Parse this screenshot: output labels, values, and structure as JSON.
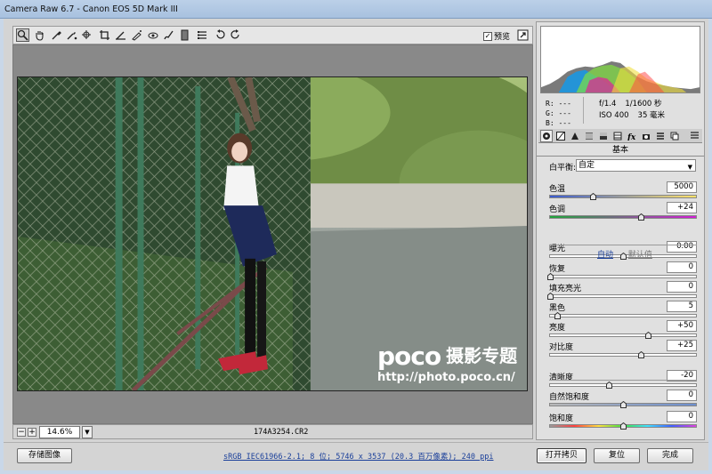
{
  "window": {
    "title": "Camera Raw 6.7  -  Canon EOS 5D Mark III"
  },
  "toolbar": {
    "tools": [
      "zoom-icon",
      "hand-icon",
      "white-balance-icon",
      "color-sampler-icon",
      "target-adjust-icon",
      "crop-icon",
      "straighten-icon",
      "spot-removal-icon",
      "red-eye-icon",
      "adjustment-brush-icon",
      "graduated-filter-icon",
      "preferences-icon",
      "rotate-left-icon",
      "rotate-right-icon"
    ],
    "preview_label": "预览",
    "preview_checked": true
  },
  "image": {
    "watermark_logo": "poco",
    "watermark_cn": "摄影专题",
    "watermark_url": "http://photo.poco.cn/"
  },
  "status": {
    "zoom_minus": "−",
    "zoom_plus": "+",
    "zoom_value": "14.6%",
    "filename": "174A3254.CR2"
  },
  "info": {
    "r": "R:  ---",
    "g": "G:  ---",
    "b": "B:  ---",
    "aperture": "f/1.4",
    "shutter": "1/1600 秒",
    "iso": "ISO 400",
    "focal": "35 毫米"
  },
  "panel": {
    "section_title": "基本",
    "white_balance_label": "白平衡:",
    "white_balance_value": "自定",
    "auto_link": "自动",
    "default_link": "默认值",
    "controls": [
      {
        "label": "色温",
        "value": "5000",
        "pos": 0.29
      },
      {
        "label": "色调",
        "value": "+24",
        "pos": 0.62
      },
      {
        "label": "曝光",
        "value": "0.00",
        "pos": 0.5
      },
      {
        "label": "恢复",
        "value": "0",
        "pos": 0.0
      },
      {
        "label": "填充亮光",
        "value": "0",
        "pos": 0.0
      },
      {
        "label": "黑色",
        "value": "5",
        "pos": 0.05
      },
      {
        "label": "亮度",
        "value": "+50",
        "pos": 0.67
      },
      {
        "label": "对比度",
        "value": "+25",
        "pos": 0.62
      },
      {
        "label": "清晰度",
        "value": "-20",
        "pos": 0.4
      },
      {
        "label": "自然饱和度",
        "value": "0",
        "pos": 0.5
      },
      {
        "label": "饱和度",
        "value": "0",
        "pos": 0.5
      }
    ]
  },
  "bottom": {
    "save_label": "存储图像",
    "workflow_link": "sRGB IEC61966-2.1; 8 位; 5746 x 3537 (20.3 百万像素); 240 ppi",
    "open_label": "打开拷贝",
    "reset_label": "复位",
    "done_label": "完成"
  }
}
